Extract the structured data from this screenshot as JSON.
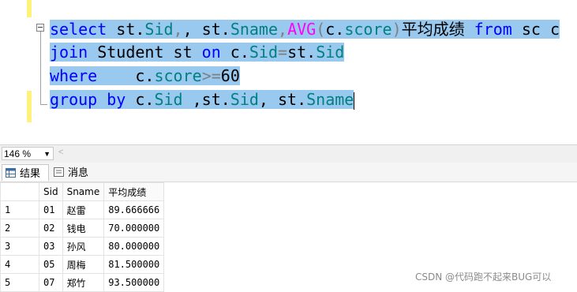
{
  "editor": {
    "line1": {
      "kw1": "select",
      "t1": " st.",
      "c1": "Sid",
      "t2": ", st.",
      "c2": "Sname",
      "p1": ",",
      "fn": "AVG",
      "p2": "(",
      "t3": "c.",
      "c3": "score",
      "p3": ")",
      "alias": "平均成绩 ",
      "kw2": "from",
      "t4": " sc c"
    },
    "line2": {
      "kw1": "join",
      "t1": " Student st ",
      "kw2": "on",
      "t2": " c.",
      "c1": "Sid",
      "op": "=",
      "t3": "st.",
      "c2": "Sid"
    },
    "line3": {
      "kw1": "where",
      "t1": "    c.",
      "c1": "score",
      "op": ">=",
      "num": "60"
    },
    "line4": {
      "kw1": "group by",
      "t1": " c.",
      "c1": "Sid",
      "t2": " ,st.",
      "c2": "Sid",
      "t3": ", st.",
      "c3": "Sname"
    }
  },
  "zoom": {
    "value": "146 %"
  },
  "tabs": [
    {
      "label": "结果"
    },
    {
      "label": "消息"
    }
  ],
  "results": {
    "columns": [
      "Sid",
      "Sname",
      "平均成绩"
    ],
    "rows": [
      {
        "n": "1",
        "sid": "01",
        "name": "赵雷",
        "avg": "89.666666"
      },
      {
        "n": "2",
        "sid": "02",
        "name": "钱电",
        "avg": "70.000000"
      },
      {
        "n": "3",
        "sid": "03",
        "name": "孙风",
        "avg": "80.000000"
      },
      {
        "n": "4",
        "sid": "05",
        "name": "周梅",
        "avg": "81.500000"
      },
      {
        "n": "5",
        "sid": "07",
        "name": "郑竹",
        "avg": "93.500000"
      }
    ]
  },
  "watermark": "CSDN @代码跑不起来BUG可以"
}
